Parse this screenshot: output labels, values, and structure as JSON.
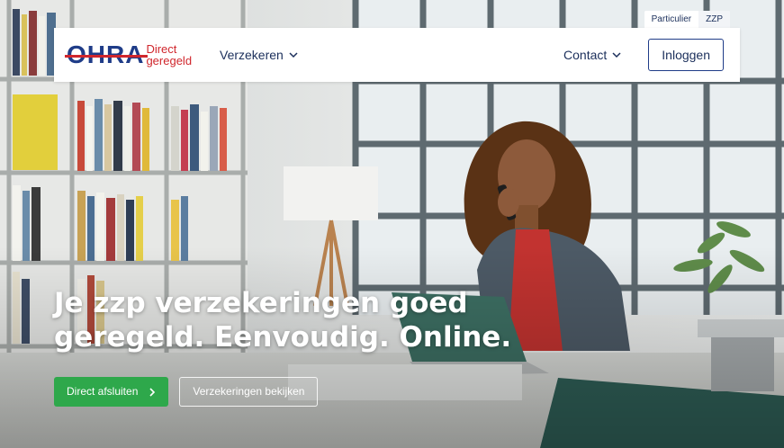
{
  "segments": [
    "Particulier",
    "ZZP"
  ],
  "logo": {
    "brand": "OHRA",
    "tagline_line1": "Direct",
    "tagline_line2": "geregeld"
  },
  "nav": {
    "insurances": "Verzekeren",
    "contact": "Contact",
    "login": "Inloggen"
  },
  "hero": {
    "headline_line1": "Je zzp verzekeringen goed",
    "headline_line2": "geregeld. Eenvoudig. Online.",
    "cta_primary": "Direct afsluiten",
    "cta_secondary": "Verzekeringen bekijken"
  },
  "colors": {
    "brand_blue": "#1f3c88",
    "brand_red": "#d0262c",
    "cta_green": "#2ea84b"
  }
}
